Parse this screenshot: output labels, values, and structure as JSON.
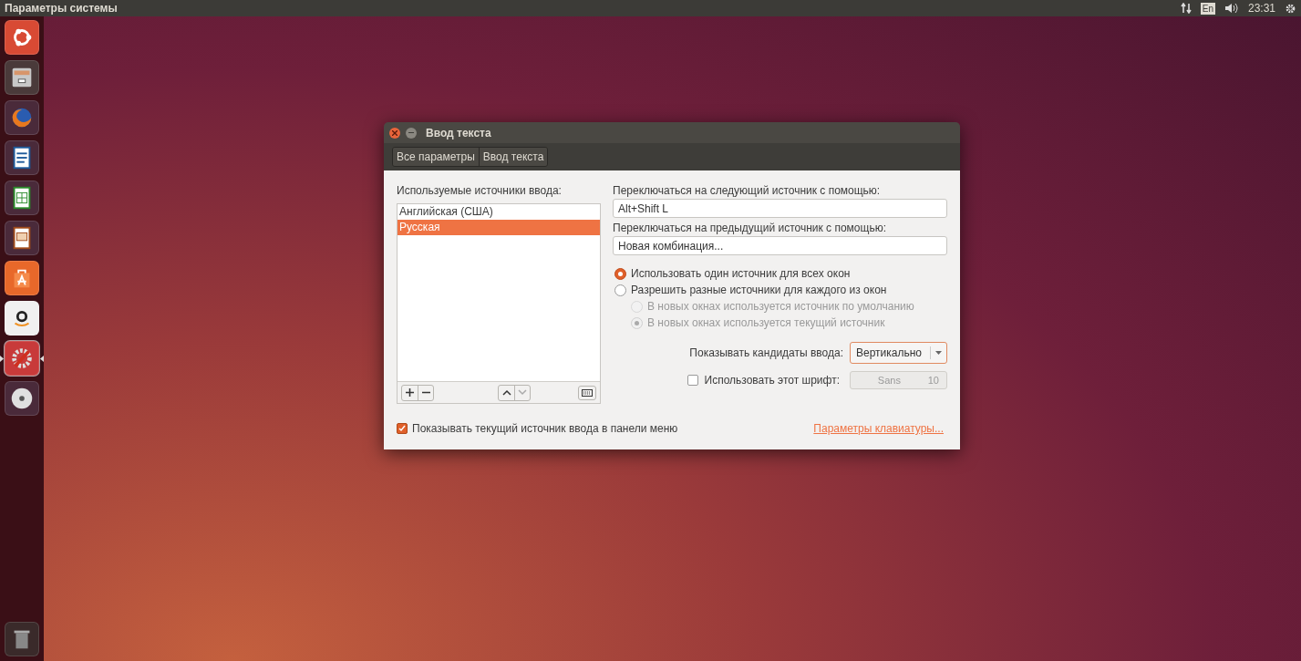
{
  "top_panel": {
    "title": "Параметры системы",
    "keyboard_layout": "En",
    "clock": "23:31"
  },
  "launcher": {
    "items": [
      {
        "kind": "ubuntu",
        "active": false
      },
      {
        "kind": "files",
        "active": false
      },
      {
        "kind": "firefox",
        "active": false
      },
      {
        "kind": "writer",
        "active": false
      },
      {
        "kind": "calc",
        "active": false
      },
      {
        "kind": "impress",
        "active": false
      },
      {
        "kind": "software",
        "active": false
      },
      {
        "kind": "amazon",
        "active": false
      },
      {
        "kind": "settings",
        "active": true
      },
      {
        "kind": "disc",
        "active": false
      }
    ],
    "trash": {
      "kind": "trash"
    }
  },
  "window": {
    "title": "Ввод текста",
    "breadcrumbs": [
      {
        "label": "Все параметры"
      },
      {
        "label": "Ввод текста"
      }
    ]
  },
  "sources": {
    "label": "Используемые источники ввода:",
    "items": [
      {
        "label": "Английская (США)",
        "selected": false
      },
      {
        "label": "Русская",
        "selected": true
      }
    ]
  },
  "next_source": {
    "label": "Переключаться на следующий источник с помощью:",
    "value": "Alt+Shift L"
  },
  "prev_source": {
    "label": "Переключаться на предыдущий источник с помощью:",
    "value": "Новая комбинация..."
  },
  "modes": [
    {
      "label": "Использовать один источник для всех окон",
      "selected": true,
      "disabled": false
    },
    {
      "label": "Разрешить разные источники для каждого из окон",
      "selected": false,
      "disabled": false,
      "children": [
        {
          "label": "В новых окнах используется источник по умолчанию",
          "selected": false,
          "disabled": true
        },
        {
          "label": "В новых окнах используется текущий источник",
          "selected": true,
          "disabled": true
        }
      ]
    }
  ],
  "candidates": {
    "label": "Показывать кандидаты ввода:",
    "value": "Вертикально"
  },
  "custom_font": {
    "label": "Использовать этот шрифт:",
    "checked": false,
    "font": "Sans",
    "size": "10"
  },
  "show_indicator": {
    "label": "Показывать текущий источник ввода в панели меню",
    "checked": true
  },
  "keyboard_link": "Параметры клавиатуры..."
}
